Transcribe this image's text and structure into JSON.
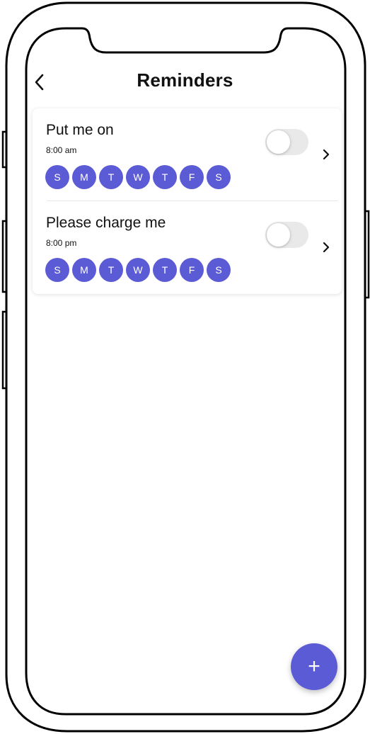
{
  "header": {
    "title": "Reminders",
    "back_icon": "chevron-left-icon"
  },
  "reminders": [
    {
      "title": "Put me on",
      "time": "8:00 am",
      "enabled": false,
      "days": [
        "S",
        "M",
        "T",
        "W",
        "T",
        "F",
        "S"
      ]
    },
    {
      "title": "Please charge me",
      "time": "8:00 pm",
      "enabled": false,
      "days": [
        "S",
        "M",
        "T",
        "W",
        "T",
        "F",
        "S"
      ]
    }
  ],
  "fab": {
    "label": "+",
    "icon": "plus-icon"
  },
  "colors": {
    "accent": "#5c5bd6",
    "toggle_off": "#e9e9ea",
    "text": "#111111"
  }
}
